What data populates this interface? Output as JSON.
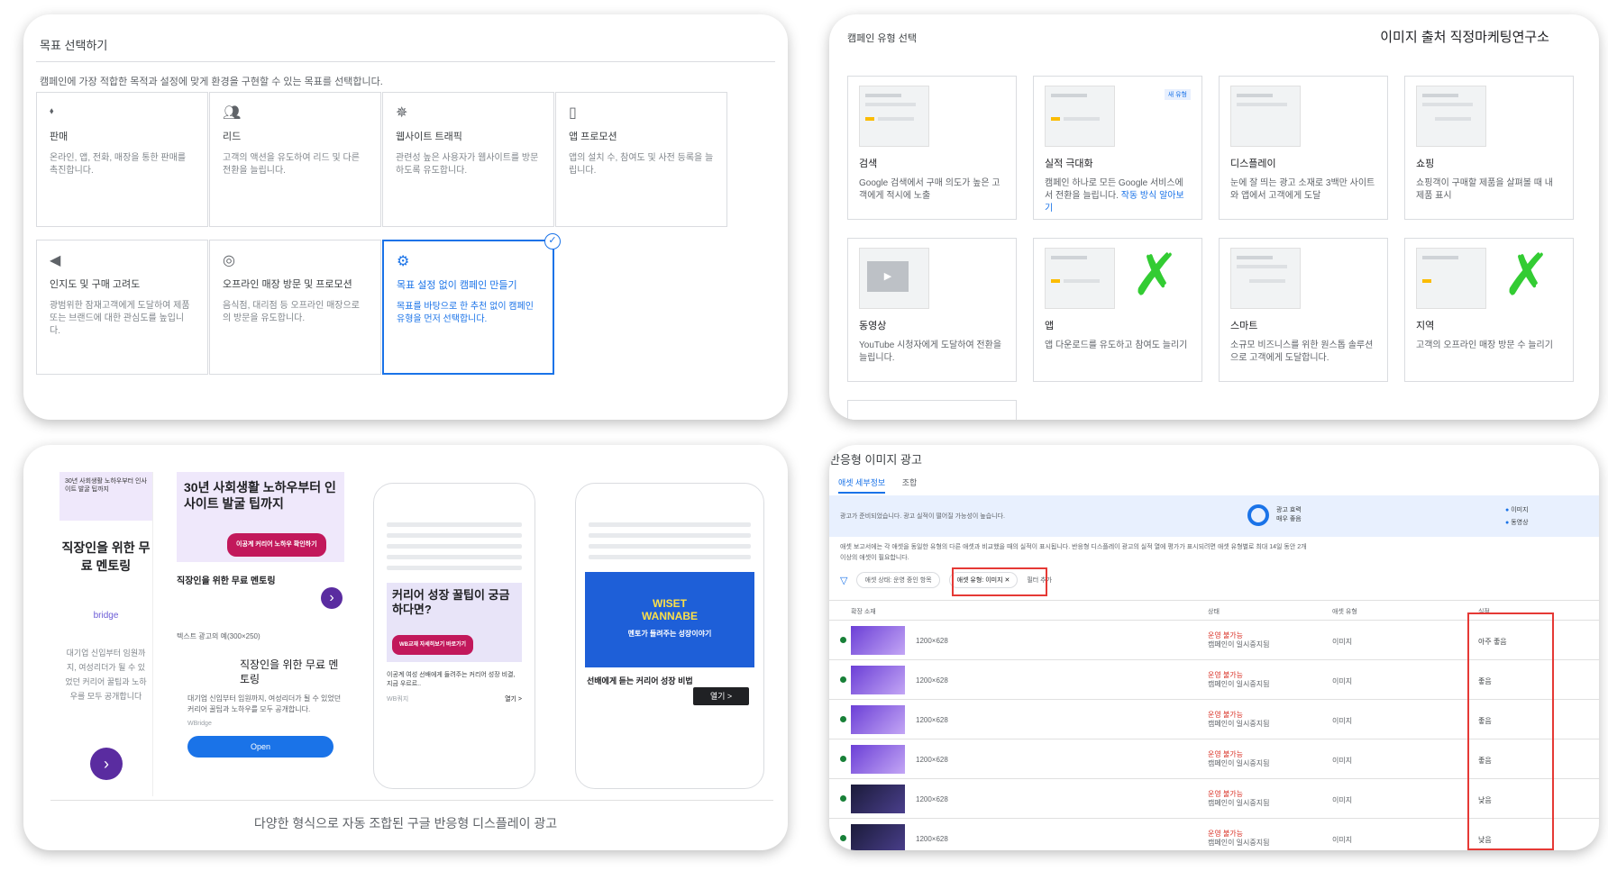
{
  "goal_panel": {
    "title": "목표 선택하기",
    "subtitle": "캠페인에 가장 적합한 목적과 설정에 맞게 환경을 구현할 수 있는 목표를 선택합니다.",
    "cards": [
      {
        "icon": "tag-icon",
        "name": "판매",
        "desc": "온라인, 앱, 전화, 매장을 통한 판매를 촉진합니다."
      },
      {
        "icon": "people-icon",
        "name": "리드",
        "desc": "고객의 액션을 유도하여 리드 및 다른 전환을 늘립니다."
      },
      {
        "icon": "cursor-click-icon",
        "name": "웹사이트 트래픽",
        "desc": "관련성 높은 사용자가 웹사이트를 방문하도록 유도합니다."
      },
      {
        "icon": "phone-icon",
        "name": "앱 프로모션",
        "desc": "앱의 설치 수, 참여도 및 사전 등록을 늘립니다."
      },
      {
        "icon": "megaphone-icon",
        "name": "인지도 및 구매 고려도",
        "desc": "광범위한 잠재고객에게 도달하여 제품 또는 브랜드에 대한 관심도를 높입니다."
      },
      {
        "icon": "location-pin-icon",
        "name": "오프라인 매장 방문 및 프로모션",
        "desc": "음식점, 대리점 등 오프라인 매장으로의 방문을 유도합니다."
      },
      {
        "icon": "gear-icon",
        "name": "목표 설정 없이 캠페인 만들기",
        "desc": "목표를 바탕으로 한 추천 없이 캠페인 유형을 먼저 선택합니다.",
        "selected": true
      }
    ]
  },
  "campaign_panel": {
    "title": "캠페인 유형 선택",
    "source": "이미지 출처 직정마케팅연구소",
    "new_badge": "새 유형",
    "cards": [
      {
        "name": "검색",
        "desc": "Google 검색에서 구매 의도가 높은 고객에게 적시에 노출"
      },
      {
        "name": "실적 극대화",
        "desc": "캠페인 하나로 모든 Google 서비스에서 전환을 늘립니다.",
        "link": "작동 방식 알아보기"
      },
      {
        "name": "디스플레이",
        "desc": "눈에 잘 띄는 광고 소재로 3백만 사이트와 앱에서 고객에게 도달"
      },
      {
        "name": "쇼핑",
        "desc": "쇼핑객이 구매할 제품을 살펴볼 때 내 제품 표시"
      },
      {
        "name": "동영상",
        "desc": "YouTube 시청자에게 도달하여 전환을 늘립니다."
      },
      {
        "name": "앱",
        "desc": "앱 다운로드를 유도하고 참여도 늘리기"
      },
      {
        "name": "스마트",
        "desc": "소규모 비즈니스를 위한 원스톱 솔루션으로 고객에게 도달합니다."
      },
      {
        "name": "지역",
        "desc": "고객의 오프라인 매장 방문 수 늘리기"
      }
    ]
  },
  "ads_panel": {
    "ad1": {
      "headline": "30년 사회생활 노하우부터 인사이트 발굴 팁까지",
      "title": "직장인을 위한 무료 멘토링",
      "brand": "bridge",
      "body": "대기업 신입부터 임원까지, 여성리더가 될 수 있었던 커리어 꿀팁과 노하우를 모두 공개합니다"
    },
    "ad2": {
      "headline": "30년 사회생활 노하우부터 인사이트 발굴 팁까지",
      "cta_pill": "이공계 커리어 노하우 확인하기",
      "title": "직장인을 위한 무료 멘토링",
      "text_label": "텍스트 광고의 예(300×250)",
      "text_title": "직장인을 위한 무료 멘토링",
      "text_body": "대기업 신입부터 임원까지, 여성리더가 될 수 있었던 커리어 꿀팁과 노하우를 모두 공개합니다.",
      "brand": "WBridge",
      "open": "Open"
    },
    "ad3": {
      "headline": "커리어 성장 꿀팁이 궁금하다면?",
      "pill": "WB교재 자세히보기 바로가기",
      "body": "이공계 여성 선배에게 들려주는 커리어 성장 비결, 지금 우르르..",
      "brand": "WB쿼지",
      "more": "열기 >"
    },
    "ad4": {
      "banner_line1": "WISET",
      "banner_line2": "WANNABE",
      "banner_sub": "멘토가 들려주는 성장이야기",
      "title": "선배에게 듣는 커리어 성장 비법",
      "open": "열기 >"
    },
    "caption": "다양한 형식으로 자동 조합된 구글 반응형 디스플레이 광고"
  },
  "responsive_panel": {
    "title": "반응형 이미지 광고",
    "tabs": [
      "애셋 세부정보",
      "조합"
    ],
    "info": "광고가 준비되었습니다. 광고 실적이 떨어질 가능성이 높습니다.",
    "ad_strength_label": "광고 효력",
    "ad_strength_value": "매우 좋음",
    "legend": [
      "이미지",
      "동영상"
    ],
    "notice": "애셋 보고서에는 각 애셋을 동일한 유형의 다른 애셋과 비교했을 때의 실적이 표시됩니다. 반응형 디스플레이 광고의 실적 열에 평가가 표시되려면 애셋 유형별로 최대 14일 동안 2개 이상의 애셋이 필요합니다.",
    "filter1": "애셋 상태: 운영 중인 항목",
    "filter2": "애셋 유형: 이미지",
    "filter_more": "필터 추가",
    "columns": [
      "확장 소재",
      "상태",
      "애셋 유형",
      "실적"
    ],
    "rows": [
      {
        "size": "1200×628",
        "status": "운영 불가능",
        "status2": "캠페인이 일시중지됨",
        "type": "이미지",
        "perf": "아주 좋음"
      },
      {
        "size": "1200×628",
        "status": "운영 불가능",
        "status2": "캠페인이 일시중지됨",
        "type": "이미지",
        "perf": "좋음"
      },
      {
        "size": "1200×628",
        "status": "운영 불가능",
        "status2": "캠페인이 일시중지됨",
        "type": "이미지",
        "perf": "좋음"
      },
      {
        "size": "1200×628",
        "status": "운영 불가능",
        "status2": "캠페인이 일시중지됨",
        "type": "이미지",
        "perf": "좋음"
      },
      {
        "size": "1200×628",
        "status": "운영 불가능",
        "status2": "캠페인이 일시중지됨",
        "type": "이미지",
        "perf": "낮음"
      },
      {
        "size": "1200×628",
        "status": "운영 불가능",
        "status2": "캠페인이 일시중지됨",
        "type": "이미지",
        "perf": "낮음"
      }
    ]
  }
}
